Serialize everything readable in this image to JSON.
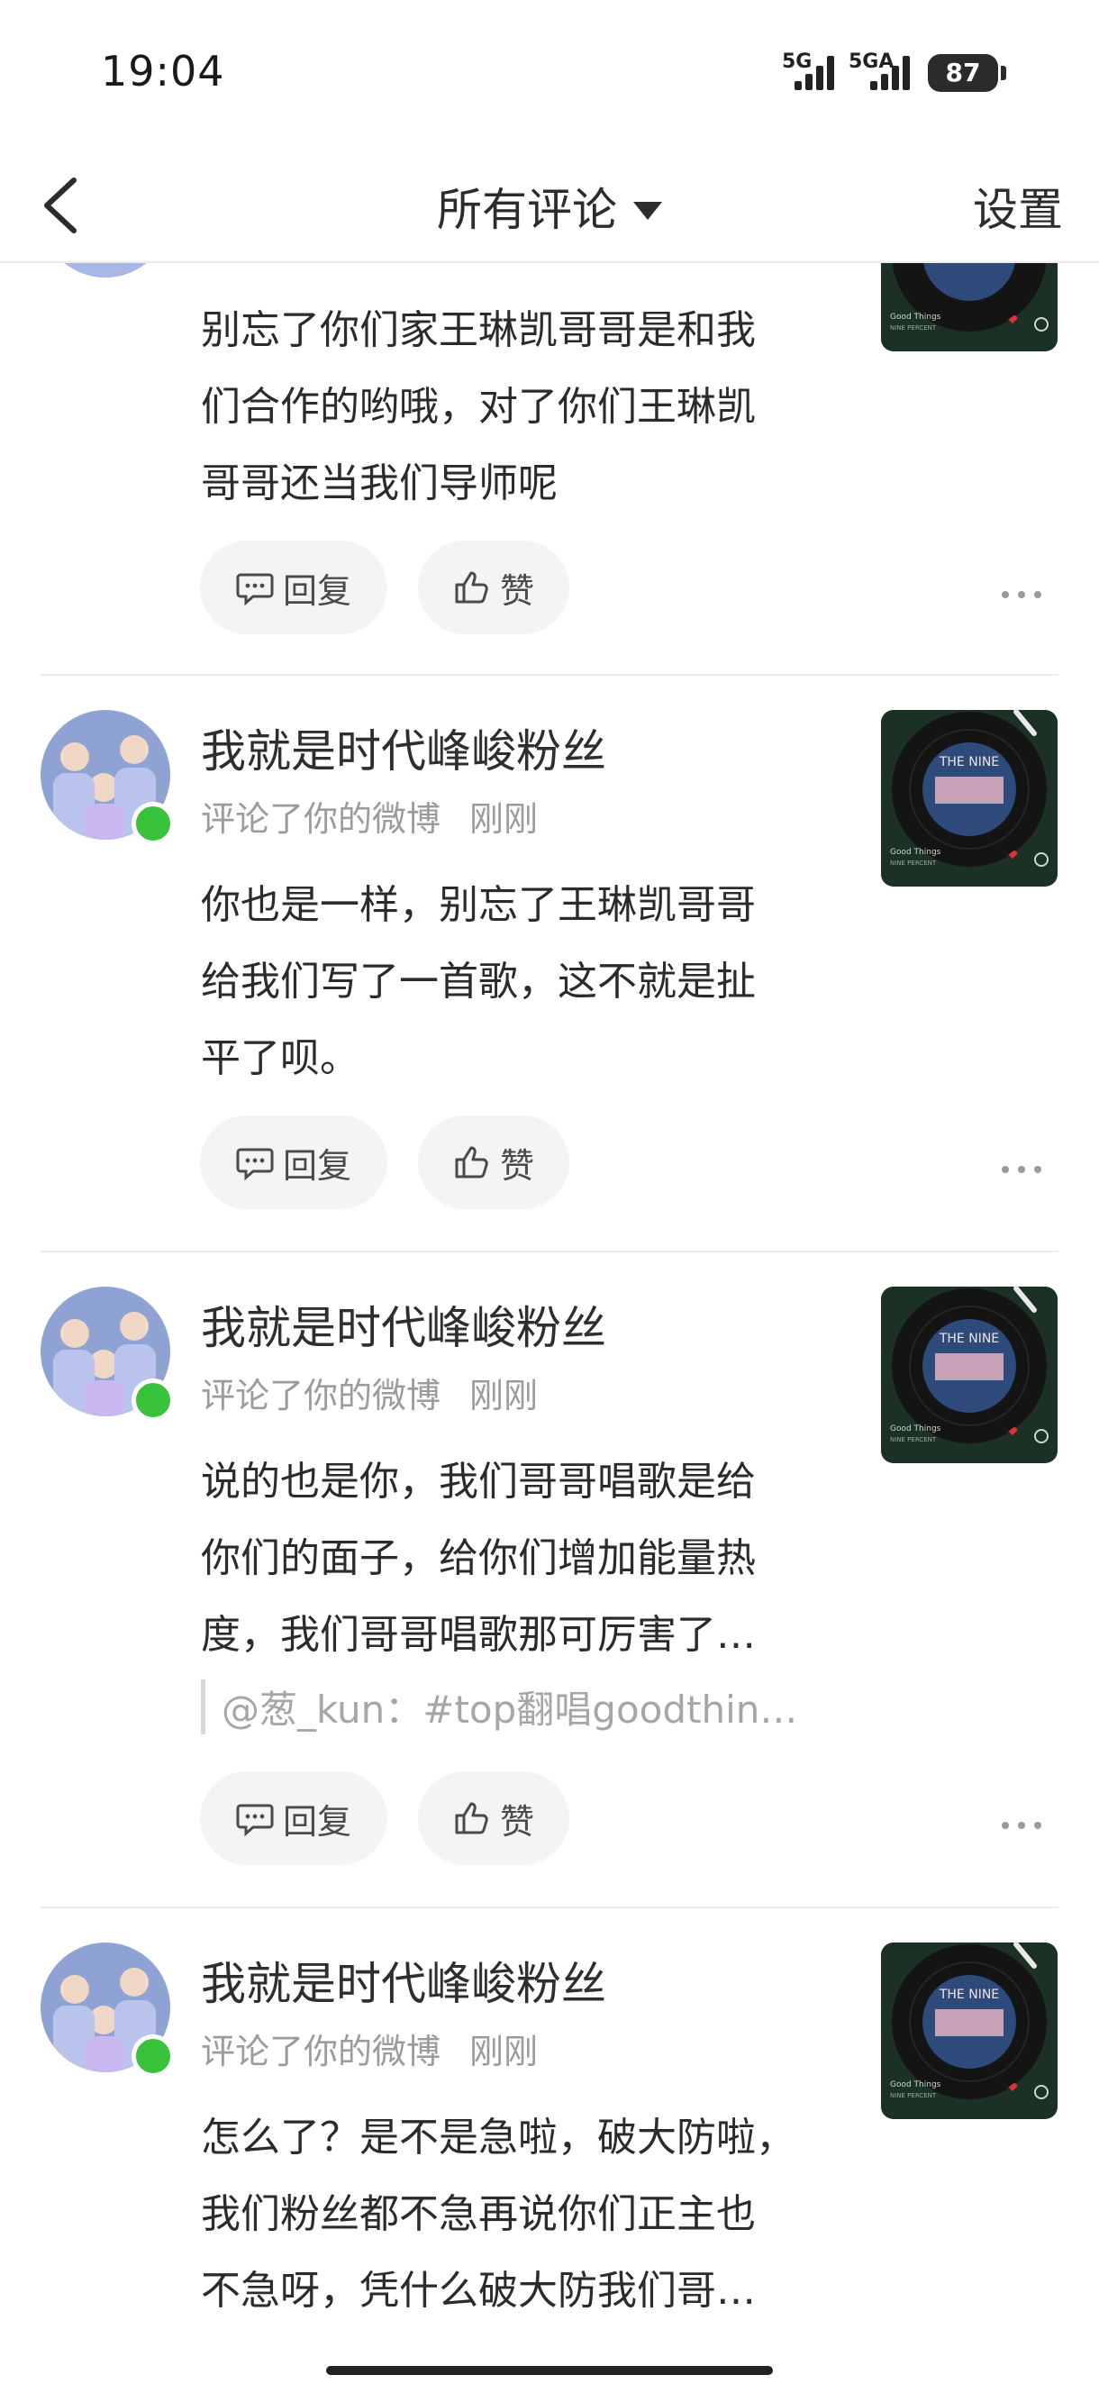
{
  "status_bar": {
    "time": "19:04",
    "net1": "5G",
    "net2": "5GA",
    "battery": "87"
  },
  "nav": {
    "title": "所有评论",
    "settings": "设置"
  },
  "actions": {
    "reply": "回复",
    "like": "赞"
  },
  "comments": [
    {
      "name": "",
      "meta_action": "",
      "meta_time": "",
      "lines": [
        "别忘了你们家王琳凯哥哥是和我",
        "们合作的哟哦，对了你们王琳凯",
        "哥哥还当我们导师呢"
      ]
    },
    {
      "name": "我就是时代峰峻粉丝",
      "meta_action": "评论了你的微博",
      "meta_time": "刚刚",
      "lines": [
        "你也是一样，别忘了王琳凯哥哥",
        "给我们写了一首歌，这不就是扯",
        "平了呗。"
      ]
    },
    {
      "name": "我就是时代峰峻粉丝",
      "meta_action": "评论了你的微博",
      "meta_time": "刚刚",
      "lines": [
        "说的也是你，我们哥哥唱歌是给",
        "你们的面子，给你们增加能量热",
        "度，我们哥哥唱歌那可厉害了…"
      ],
      "quote": "@葱_kun：#top翻唱goodthin…"
    },
    {
      "name": "我就是时代峰峻粉丝",
      "meta_action": "评论了你的微博",
      "meta_time": "刚刚",
      "lines": [
        "怎么了？是不是急啦，破大防啦，",
        "我们粉丝都不急再说你们正主也",
        "不急呀，凭什么破大防我们哥…"
      ]
    }
  ],
  "thumbnail": {
    "song": "Good Things",
    "artist": "NINE PERCENT",
    "band_text": "THE NINE"
  },
  "colors": {
    "online": "#39c23b",
    "thumb_bg": "#1b3125",
    "like_heart": "#e0323a"
  }
}
